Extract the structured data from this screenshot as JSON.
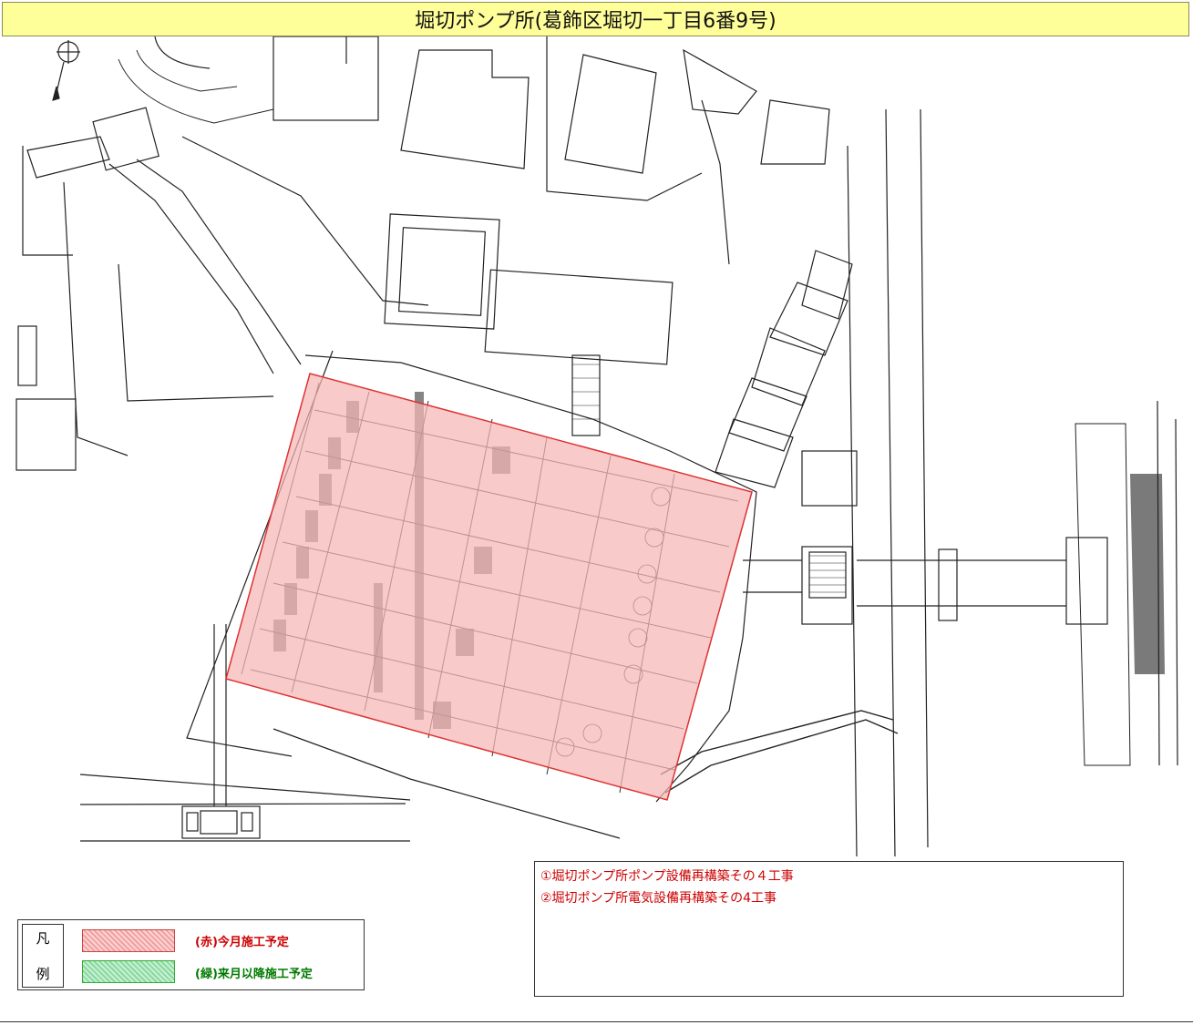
{
  "title": "堀切ポンプ所(葛飾区堀切一丁目6番9号)",
  "projects": [
    "①堀切ポンプ所ポンプ設備再構築その４工事",
    "②堀切ポンプ所電気設備再構築その4工事"
  ],
  "legend": {
    "heading_top": "凡",
    "heading_bottom": "例",
    "items": [
      {
        "label": "(赤)今月施工予定",
        "color": "#cc0000"
      },
      {
        "label": "(緑)来月以降施工予定",
        "color": "#007a00"
      }
    ]
  },
  "colors": {
    "title_background": "#ffff99",
    "current_month_area": "#f7b6b6",
    "next_month_area": "#9fe0b0"
  },
  "map": {
    "icons": [
      "north-arrow-icon"
    ]
  }
}
